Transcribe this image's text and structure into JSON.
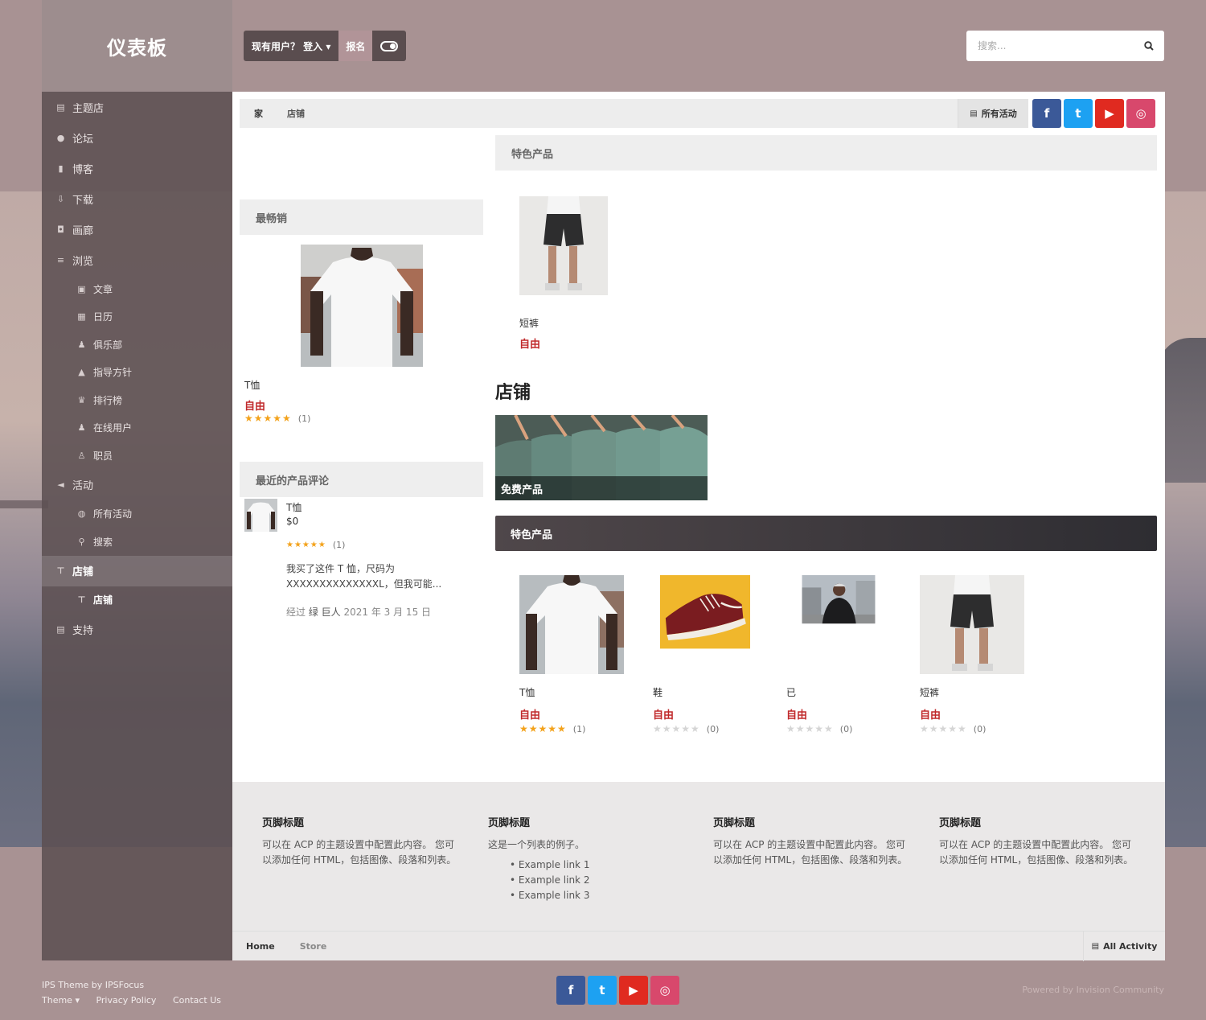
{
  "sidebar": {
    "logo": "仪表板",
    "items": [
      {
        "label": "主题店",
        "icon": "document-icon",
        "level": "top"
      },
      {
        "label": "论坛",
        "icon": "comments-icon",
        "level": "top"
      },
      {
        "label": "博客",
        "icon": "book-icon",
        "level": "top"
      },
      {
        "label": "下载",
        "icon": "download-icon",
        "level": "top"
      },
      {
        "label": "画廊",
        "icon": "camera-icon",
        "level": "top"
      },
      {
        "label": "浏览",
        "icon": "list-icon",
        "level": "top"
      },
      {
        "label": "文章",
        "icon": "article-icon",
        "level": "sub"
      },
      {
        "label": "日历",
        "icon": "calendar-icon",
        "level": "sub"
      },
      {
        "label": "俱乐部",
        "icon": "users-icon",
        "level": "sub"
      },
      {
        "label": "指导方针",
        "icon": "warning-icon",
        "level": "sub"
      },
      {
        "label": "排行榜",
        "icon": "trophy-icon",
        "level": "sub"
      },
      {
        "label": "在线用户",
        "icon": "online-users-icon",
        "level": "sub"
      },
      {
        "label": "职员",
        "icon": "user-icon",
        "level": "sub"
      },
      {
        "label": "活动",
        "icon": "megaphone-icon",
        "level": "top"
      },
      {
        "label": "所有活动",
        "icon": "globe-icon",
        "level": "sub"
      },
      {
        "label": "搜索",
        "icon": "search-icon",
        "level": "sub"
      },
      {
        "label": "店铺",
        "icon": "cart-icon",
        "level": "top",
        "active": true
      },
      {
        "label": "店铺",
        "icon": "cart-icon",
        "level": "sub",
        "active": true
      },
      {
        "label": "支持",
        "icon": "support-icon",
        "level": "top"
      }
    ]
  },
  "header": {
    "existing_user": "现有用户？ 登入 ▾",
    "signup": "报名",
    "search_placeholder": "搜索..."
  },
  "breadcrumb": {
    "home": "家",
    "store": "店铺",
    "all_activity": "所有活动"
  },
  "social": {
    "facebook": "f",
    "twitter": "t",
    "youtube": "▶",
    "instagram": "◎"
  },
  "bestseller": {
    "heading": "最畅销",
    "name": "T恤",
    "price": "自由",
    "stars": "★★★★★",
    "count": "(1)"
  },
  "reviews": {
    "heading": "最近的产品评论",
    "product": "T恤",
    "price": "$0",
    "stars": "★★★★★",
    "count": "(1)",
    "text": "我买了这件 T 恤，尺码为 XXXXXXXXXXXXXXL，但我可能...",
    "meta_prefix": "经过",
    "author": "绿 巨人",
    "date": "2021 年 3 月 15 日"
  },
  "featured": {
    "heading": "特色产品",
    "name": "短裤",
    "price": "自由"
  },
  "store": {
    "title": "店铺",
    "category_label": "免费产品",
    "featured_heading": "特色产品",
    "products": [
      {
        "name": "T恤",
        "price": "自由",
        "stars": "★★★★★",
        "count": "(1)",
        "rated": true
      },
      {
        "name": "鞋",
        "price": "自由",
        "stars": "★★★★★",
        "count": "(0)",
        "rated": false
      },
      {
        "name": "已",
        "price": "自由",
        "stars": "★★★★★",
        "count": "(0)",
        "rated": false
      },
      {
        "name": "短裤",
        "price": "自由",
        "stars": "★★★★★",
        "count": "(0)",
        "rated": false
      }
    ]
  },
  "footer": {
    "cols": [
      {
        "title": "页脚标题",
        "text": "可以在 ACP 的主题设置中配置此内容。 您可以添加任何 HTML，包括图像、段落和列表。"
      },
      {
        "title": "页脚标题",
        "text": "这是一个列表的例子。",
        "links": [
          "Example link 1",
          "Example link 2",
          "Example link 3"
        ]
      },
      {
        "title": "页脚标题",
        "text": "可以在 ACP 的主题设置中配置此内容。 您可以添加任何 HTML，包括图像、段落和列表。"
      },
      {
        "title": "页脚标题",
        "text": "可以在 ACP 的主题设置中配置此内容。 您可以添加任何 HTML，包括图像、段落和列表。"
      }
    ],
    "bc_home": "Home",
    "bc_store": "Store",
    "all_activity": "All Activity"
  },
  "bottom": {
    "credit": "IPS Theme by IPSFocus",
    "theme": "Theme ▾",
    "privacy": "Privacy Policy",
    "contact": "Contact Us",
    "powered": "Powered by Invision Community"
  },
  "colors": {
    "price_red": "#c0292b",
    "star_gold": "#f3a21b",
    "facebook": "#3b5998",
    "twitter": "#1da1f2",
    "youtube": "#e02a20",
    "instagram": "#d8486c"
  }
}
